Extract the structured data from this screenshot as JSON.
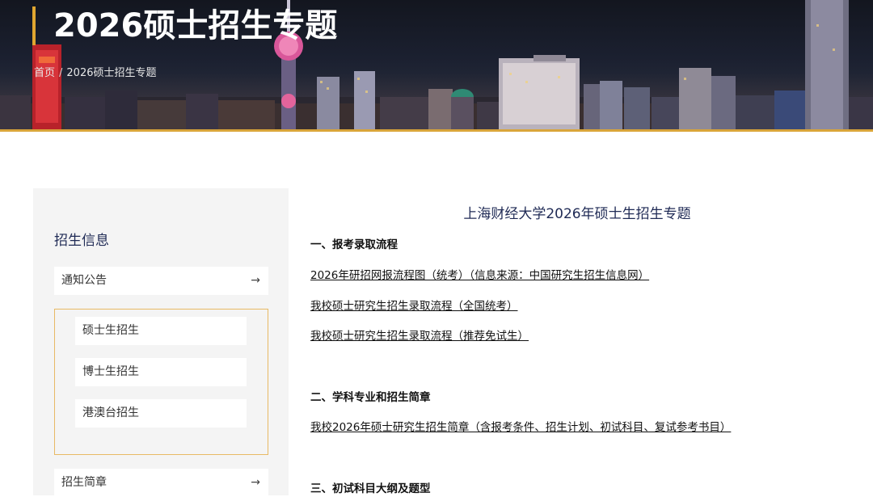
{
  "banner": {
    "title": "2026硕士招生专题",
    "breadcrumb": [
      {
        "label": "首页"
      },
      {
        "label": "2026硕士招生专题"
      }
    ],
    "breadcrumb_separator": "/",
    "accent_color": "#e0a630"
  },
  "sidebar": {
    "title": "招生信息",
    "items": [
      {
        "label": "通知公告",
        "icon": "arrow-right-icon"
      },
      {
        "label": "招生简章",
        "icon": "arrow-right-icon"
      }
    ],
    "sub_items": [
      {
        "label": "硕士生招生"
      },
      {
        "label": "博士生招生"
      },
      {
        "label": "港澳台招生"
      }
    ],
    "highlight_color": "#e8b964"
  },
  "main": {
    "title": "上海财经大学2026年硕士生招生专题",
    "sections": [
      {
        "heading": "一、报考录取流程",
        "links": [
          "2026年研招网报流程图（统考）（信息来源：中国研究生招生信息网）",
          "我校硕士研究生招生录取流程（全国统考）",
          "我校硕士研究生招生录取流程（推荐免试生）"
        ]
      },
      {
        "heading": "二、学科专业和招生简章",
        "links": [
          "我校2026年硕士研究生招生简章（含报考条件、招生计划、初试科目、复试参考书目）"
        ]
      },
      {
        "heading": "三、初试科目大纲及题型",
        "links": []
      }
    ]
  }
}
